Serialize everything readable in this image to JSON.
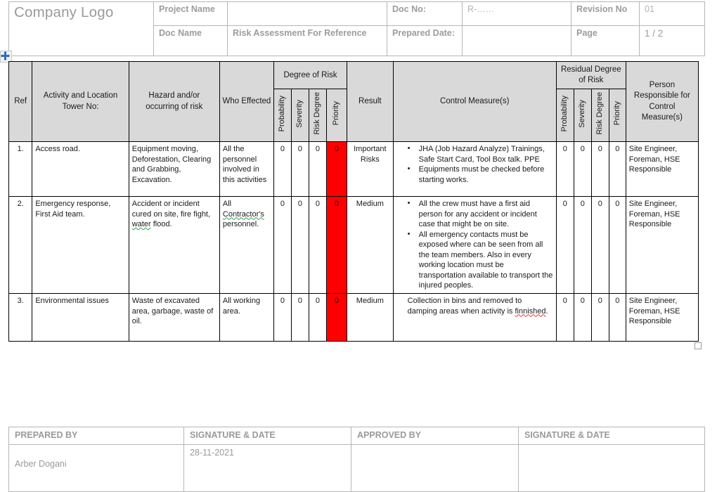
{
  "header": {
    "logo_text": "Company Logo",
    "project_name_label": "Project Name",
    "project_name_value": "",
    "doc_no_label": "Doc No:",
    "doc_no_value": "R-……",
    "revision_no_label": "Revision No",
    "revision_no_value": "01",
    "doc_name_label": "Doc Name",
    "doc_name_value": "Risk Assessment For Reference",
    "prepared_date_label": "Prepared Date:",
    "prepared_date_value": "",
    "page_label": "Page",
    "page_value": "1 / 2"
  },
  "risk_table": {
    "columns": {
      "ref": "Ref",
      "activity": "Activity and Location Tower No:",
      "hazard": "Hazard and/or occurring of risk",
      "who": "Who Effected",
      "degree_group": "Degree of Risk",
      "probability": "Probability",
      "severity": "Severity",
      "risk_degree": "Risk Degree",
      "priority": "Priority",
      "result": "Result",
      "control": "Control Measure(s)",
      "residual_group": "Residual Degree of Risk",
      "person": "Person Responsible for Control Measure(s)"
    },
    "priority_fill_color": "#FF0000",
    "rows": [
      {
        "ref": "1.",
        "activity": "Access road.",
        "hazard": "Equipment moving, Deforestation, Clearing and Grabbing, Excavation.",
        "who": "All the personnel involved in this activities",
        "probability": "0",
        "severity": "0",
        "risk_degree": "0",
        "priority": "0",
        "result": "Important Risks",
        "control_measures": [
          "JHA (Job Hazard Analyze) Trainings, Safe Start Card, Tool Box talk. PPE",
          "Equipments must be checked before starting works."
        ],
        "control_bulleted": true,
        "res_probability": "0",
        "res_severity": "0",
        "res_risk_degree": "0",
        "res_priority": "0",
        "person": "Site Engineer, Foreman,  HSE Responsible"
      },
      {
        "ref": "2.",
        "activity": "Emergency response, First Aid team.",
        "hazard": "Accident or incident cured on site, fire fight, water flood.",
        "who": "All Contractor's personnel.",
        "probability": "0",
        "severity": "0",
        "risk_degree": "0",
        "priority": "0",
        "result": "Medium",
        "control_measures": [
          "All the crew must have a first aid person for any accident or incident case that might be on site.",
          "All emergency contacts must be exposed where can be seen from all the team members. Also in every working location must be transportation available to transport the injured peoples."
        ],
        "control_bulleted": true,
        "res_probability": "0",
        "res_severity": "0",
        "res_risk_degree": "0",
        "res_priority": "0",
        "person": "Site Engineer, Foreman, HSE Responsible"
      },
      {
        "ref": "3.",
        "activity": "Environmental issues",
        "hazard": "Waste of excavated area, garbage, waste of oil.",
        "who": "All working area.",
        "probability": "0",
        "severity": "0",
        "risk_degree": "0",
        "priority": "0",
        "result": "Medium",
        "control_measures": [
          "Collection in bins and removed to damping areas when  activity is finnished."
        ],
        "control_bulleted": false,
        "res_probability": "0",
        "res_severity": "0",
        "res_risk_degree": "0",
        "res_priority": "0",
        "person": "Site Engineer, Foreman, HSE Responsible"
      }
    ]
  },
  "signature_table": {
    "prepared_by_label": "PREPARED BY",
    "signature_date_label_1": "SIGNATURE & DATE",
    "approved_by_label": "APPROVED BY",
    "signature_date_label_2": "SIGNATURE & DATE",
    "prepared_by_value": "Arber Dogani",
    "signature_date_value_1": "28-11-2021",
    "approved_by_value": "",
    "signature_date_value_2": ""
  }
}
